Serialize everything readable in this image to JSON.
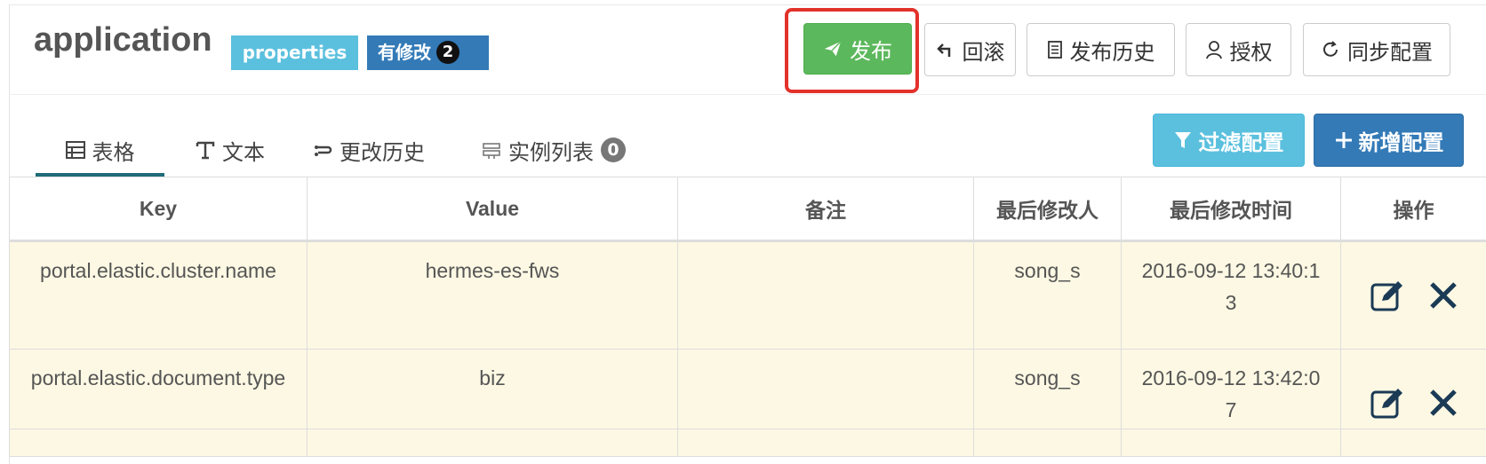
{
  "header": {
    "app_name": "application",
    "format_label": "properties",
    "modified_label": "有修改",
    "modified_count": "2"
  },
  "toolbar": {
    "publish": "发布",
    "rollback": "回滚",
    "publish_history": "发布历史",
    "authorize": "授权",
    "sync_config": "同步配置"
  },
  "tabs": [
    {
      "label": "表格",
      "icon": "table-icon"
    },
    {
      "label": "文本",
      "icon": "text-icon"
    },
    {
      "label": "更改历史",
      "icon": "history-icon"
    },
    {
      "label": "实例列表",
      "icon": "server-icon",
      "count": "0"
    }
  ],
  "actions": {
    "filter": "过滤配置",
    "add": "新增配置"
  },
  "table": {
    "headers": [
      "Key",
      "Value",
      "备注",
      "最后修改人",
      "最后修改时间",
      "操作"
    ],
    "rows": [
      {
        "key": "portal.elastic.cluster.name",
        "value": "hermes-es-fws",
        "comment": "",
        "modifier": "song_s",
        "time": "2016-09-12 13:40:13"
      },
      {
        "key": "portal.elastic.document.type",
        "value": "biz",
        "comment": "",
        "modifier": "song_s",
        "time": "2016-09-12 13:42:07"
      }
    ]
  },
  "colors": {
    "success": "#5cb85c",
    "info": "#5bc0de",
    "primary": "#337ab7",
    "row_highlight": "#fcf8e3",
    "annotation_box": "#e3322b"
  }
}
